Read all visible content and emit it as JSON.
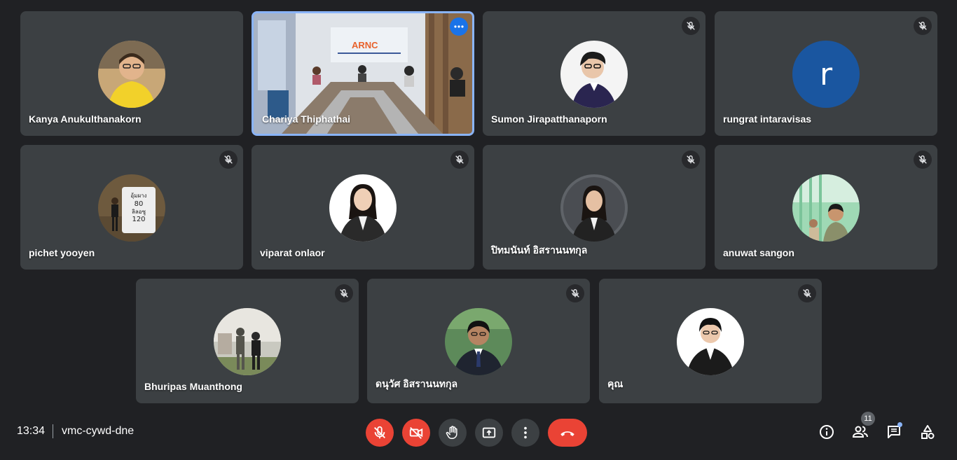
{
  "meeting": {
    "time": "13:34",
    "code": "vmc-cywd-dne"
  },
  "participants": [
    {
      "name": "Kanya Anukulthanakorn",
      "muted": false,
      "avatar": "photo-woman-yellow"
    },
    {
      "name": "Chariya Thiphathai",
      "muted": false,
      "video": true,
      "active": true,
      "banner": "ARNC"
    },
    {
      "name": "Sumon Jirapatthanaporn",
      "muted": true,
      "avatar": "photo-man-suit"
    },
    {
      "name": "rungrat intaravisas",
      "muted": true,
      "initial": "r"
    },
    {
      "name": "pichet yooyen",
      "muted": true,
      "avatar": "photo-milestone",
      "sign": [
        "อุ้มผาง",
        "80",
        "ลิลอซู",
        "120"
      ]
    },
    {
      "name": "viparat onlaor",
      "muted": true,
      "avatar": "photo-woman-suit"
    },
    {
      "name": "ปิทมนันท์ อิสรานนทกุล",
      "muted": true,
      "avatar": "photo-woman-suit-2"
    },
    {
      "name": "anuwat sangon",
      "muted": true,
      "avatar": "photo-man-green"
    },
    {
      "name": "Bhuripas Muanthong",
      "muted": true,
      "avatar": "photo-statue"
    },
    {
      "name": "ดนุวัศ อิสรานนทกุล",
      "muted": true,
      "avatar": "photo-man-tie"
    },
    {
      "name": "คุณ",
      "muted": true,
      "avatar": "photo-man-suit-white"
    }
  ],
  "controls": {
    "mic": "mic-off-icon",
    "camera": "videocam-off-icon",
    "raise_hand": "hand-icon",
    "present": "present-screen-icon",
    "more": "more-vert-icon",
    "leave": "call-end-icon"
  },
  "side": {
    "people_count": "11",
    "icons": [
      "info-icon",
      "people-icon",
      "chat-icon",
      "activities-icon"
    ]
  },
  "colors": {
    "background": "#202124",
    "tile": "#3c4043",
    "danger": "#ea4335",
    "accent": "#8ab4f8"
  }
}
